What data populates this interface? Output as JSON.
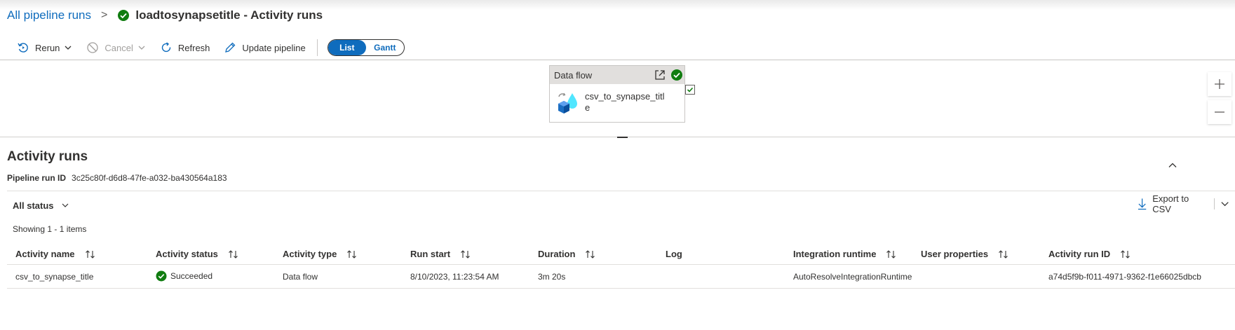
{
  "breadcrumb": {
    "root": "All pipeline runs",
    "separator": ">",
    "title": "loadtosynapsetitle - Activity runs"
  },
  "toolbar": {
    "rerun": "Rerun",
    "cancel": "Cancel",
    "refresh": "Refresh",
    "update_pipeline": "Update pipeline",
    "view_list": "List",
    "view_gantt": "Gantt",
    "active_view": "List"
  },
  "canvas": {
    "activity": {
      "type": "Data flow",
      "name": "csv_to_synapse_title",
      "status_icon": "success-check-icon"
    },
    "zoom_in_icon": "plus-icon",
    "zoom_out_icon": "minus-icon"
  },
  "section": {
    "title": "Activity runs",
    "pipeline_run_id_label": "Pipeline run ID",
    "pipeline_run_id": "3c25c80f-d6d8-47fe-a032-ba430564a183"
  },
  "filters": {
    "status": "All status",
    "export": "Export to CSV",
    "showing": "Showing 1 - 1 items"
  },
  "table": {
    "columns": [
      "Activity name",
      "Activity status",
      "Activity type",
      "Run start",
      "Duration",
      "Log",
      "Integration runtime",
      "User properties",
      "Activity run ID"
    ],
    "rows": [
      {
        "activity_name": "csv_to_synapse_title",
        "status": "Succeeded",
        "type": "Data flow",
        "run_start": "8/10/2023, 11:23:54 AM",
        "duration": "3m 20s",
        "log": "",
        "integration_runtime": "AutoResolveIntegrationRuntime",
        "user_properties": "",
        "run_id": "a74d5f9b-f011-4971-9362-f1e66025dbcb"
      }
    ]
  },
  "colors": {
    "accent": "#0f6cbd",
    "success": "#107c10",
    "text": "#323130"
  }
}
